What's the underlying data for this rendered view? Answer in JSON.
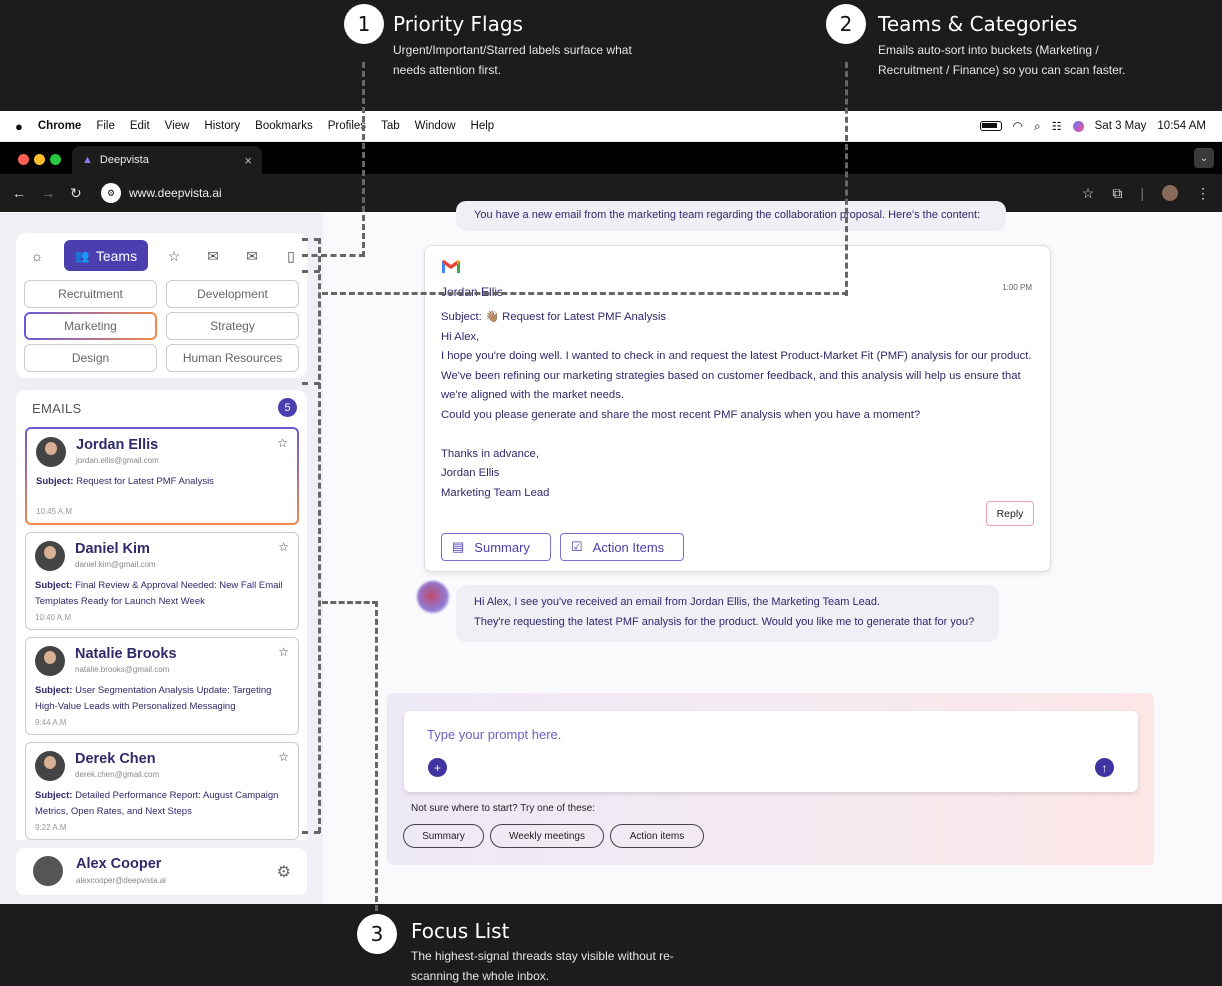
{
  "callouts": [
    {
      "num": "1",
      "title": "Priority Flags",
      "desc": "Urgent/Important/Starred labels surface what needs attention first."
    },
    {
      "num": "2",
      "title": "Teams & Categories",
      "desc": "Emails auto-sort into buckets (Marketing / Recruitment / Finance) so you can scan faster."
    },
    {
      "num": "3",
      "title": "Focus List",
      "desc": "The highest-signal threads stay visible without re-scanning the whole inbox."
    }
  ],
  "menubar": {
    "app": "Chrome",
    "items": [
      "File",
      "Edit",
      "View",
      "History",
      "Bookmarks",
      "Profiles",
      "Tab",
      "Window",
      "Help"
    ],
    "date": "Sat 3 May",
    "time": "10:54 AM"
  },
  "browser": {
    "tab_title": "Deepvista",
    "tab_close": "×",
    "url": "www.deepvista.ai"
  },
  "sidebar": {
    "teams_label": "Teams",
    "categories": [
      "Recruitment",
      "Development",
      "Marketing",
      "Strategy",
      "Design",
      "Human Resources"
    ],
    "selected_category": "Marketing",
    "emails_header": "EMAILS",
    "emails_count": "5",
    "emails": [
      {
        "name": "Jordan Ellis",
        "email": "jordan.ellis@gmail.com",
        "subject_label": "Subject:",
        "subject": "Request for Latest PMF Analysis",
        "time": "10:45 A.M"
      },
      {
        "name": "Daniel Kim",
        "email": "daniel.kim@gmail.com",
        "subject_label": "Subject:",
        "subject": "Final Review & Approval Needed: New Fall Email Templates Ready for Launch Next Week",
        "time": "10:40 A.M"
      },
      {
        "name": "Natalie Brooks",
        "email": "natalie.brooks@gmail.com",
        "subject_label": "Subject:",
        "subject": "User Segmentation Analysis Update: Targeting High-Value Leads with Personalized Messaging",
        "time": "9:44 A.M"
      },
      {
        "name": "Derek Chen",
        "email": "derek.chen@gmail.com",
        "subject_label": "Subject:",
        "subject": "Detailed Performance Report: August Campaign Metrics, Open Rates, and Next Steps",
        "time": "9:22 A.M"
      }
    ],
    "user": {
      "name": "Alex Cooper",
      "email": "alexcooper@deepvista.ai"
    }
  },
  "chat": {
    "prev_message": "You have a new email from the marketing team regarding the collaboration proposal. Here's the content:",
    "mail": {
      "from": "Jordan Ellis",
      "time": "1:00 PM",
      "subject_label": "Subject:",
      "subject": "👋🏽 Request for Latest PMF Analysis",
      "lines": [
        "Hi Alex,",
        "I hope you're doing well. I wanted to check in and request the latest Product-Market Fit (PMF) analysis for our product.",
        "We've been refining our marketing strategies based on customer feedback, and this analysis will help us ensure that",
        "we're aligned with the market needs.",
        "Could you please generate and share the most recent PMF analysis when you have a moment?",
        "",
        "Thanks in advance,",
        "Jordan Ellis",
        "Marketing Team Lead"
      ],
      "reply_label": "Reply",
      "summary_label": "Summary",
      "action_items_label": "Action Items"
    },
    "ai_message_1": "Hi Alex, I see you've received an email from Jordan Ellis, the Marketing Team Lead.",
    "ai_message_2": "They're requesting the latest PMF analysis for the product. Would you like me to generate that for you?"
  },
  "prompt": {
    "placeholder": "Type your prompt here.",
    "hint": "Not sure where to start? Try one of these:",
    "suggestions": [
      "Summary",
      "Weekly meetings",
      "Action items"
    ]
  },
  "colors": {
    "accent": "#4b3fb0",
    "highlight_gradient_start": "#6a5ad6",
    "highlight_gradient_end": "#f08a4b"
  }
}
